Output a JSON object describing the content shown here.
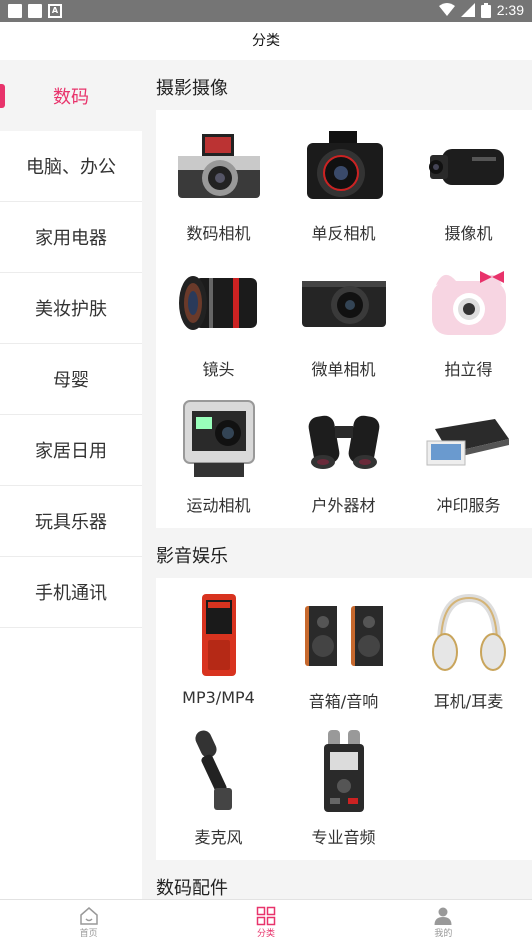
{
  "status_bar": {
    "time": "2:39"
  },
  "header": {
    "title": "分类"
  },
  "sidebar": {
    "items": [
      {
        "label": "数码",
        "active": true
      },
      {
        "label": "电脑、办公"
      },
      {
        "label": "家用电器"
      },
      {
        "label": "美妆护肤"
      },
      {
        "label": "母婴"
      },
      {
        "label": "家居日用"
      },
      {
        "label": "玩具乐器"
      },
      {
        "label": "手机通讯"
      }
    ]
  },
  "sections": [
    {
      "title": "摄影摄像",
      "items": [
        {
          "label": "数码相机",
          "icon": "digital-camera-icon"
        },
        {
          "label": "单反相机",
          "icon": "dslr-camera-icon"
        },
        {
          "label": "摄像机",
          "icon": "camcorder-icon"
        },
        {
          "label": "镜头",
          "icon": "lens-icon"
        },
        {
          "label": "微单相机",
          "icon": "mirrorless-camera-icon"
        },
        {
          "label": "拍立得",
          "icon": "instant-camera-icon"
        },
        {
          "label": "运动相机",
          "icon": "action-camera-icon"
        },
        {
          "label": "户外器材",
          "icon": "binoculars-icon"
        },
        {
          "label": "冲印服务",
          "icon": "photo-printer-icon"
        }
      ]
    },
    {
      "title": "影音娱乐",
      "items": [
        {
          "label": "MP3/MP4",
          "icon": "mp3-player-icon"
        },
        {
          "label": "音箱/音响",
          "icon": "speaker-icon"
        },
        {
          "label": "耳机/耳麦",
          "icon": "headphones-icon"
        },
        {
          "label": "麦克风",
          "icon": "microphone-icon"
        },
        {
          "label": "专业音频",
          "icon": "audio-recorder-icon"
        }
      ]
    },
    {
      "title": "数码配件",
      "items": []
    }
  ],
  "bottom_nav": [
    {
      "label": "首页",
      "icon": "home-icon"
    },
    {
      "label": "分类",
      "icon": "category-icon",
      "active": true
    },
    {
      "label": "我的",
      "icon": "user-icon"
    }
  ],
  "colors": {
    "accent": "#e8336b"
  }
}
